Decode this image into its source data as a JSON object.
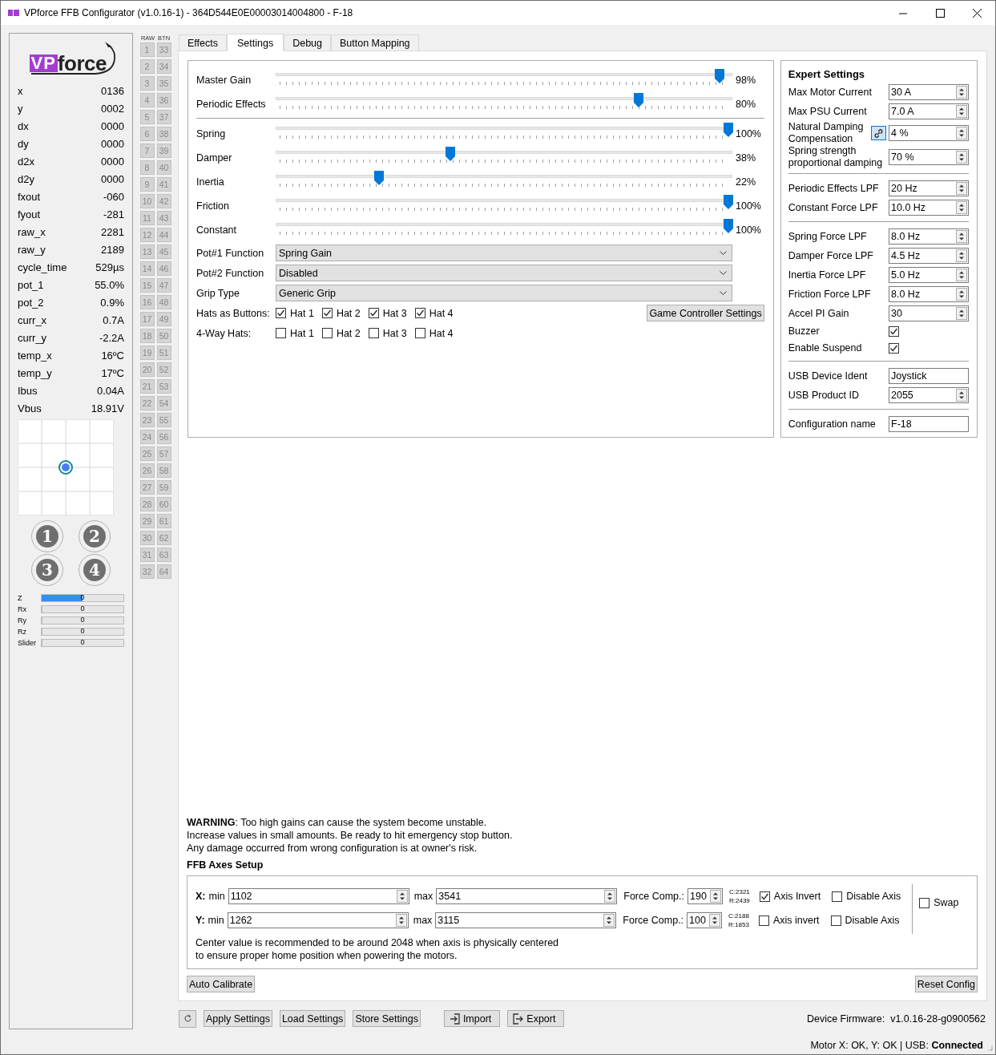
{
  "window": {
    "title": "VPforce FFB Configurator (v1.0.16-1) - 364D544E0E00003014004800 - F-18"
  },
  "sidebar": {
    "logo": {
      "accent": "VP",
      "text": "force"
    },
    "readouts": [
      {
        "label": "x",
        "value": "0136"
      },
      {
        "label": "y",
        "value": "0002"
      },
      {
        "label": "dx",
        "value": "0000"
      },
      {
        "label": "dy",
        "value": "0000"
      },
      {
        "label": "d2x",
        "value": "0000"
      },
      {
        "label": "d2y",
        "value": "0000"
      },
      {
        "label": "fxout",
        "value": "-060"
      },
      {
        "label": "fyout",
        "value": "-281"
      },
      {
        "label": "raw_x",
        "value": "2281"
      },
      {
        "label": "raw_y",
        "value": "2189"
      },
      {
        "label": "cycle_time",
        "value": "529µs"
      },
      {
        "label": "pot_1",
        "value": "55.0%"
      },
      {
        "label": "pot_2",
        "value": "0.9%"
      },
      {
        "label": "curr_x",
        "value": "0.7A"
      },
      {
        "label": "curr_y",
        "value": "-2.2A"
      },
      {
        "label": "temp_x",
        "value": "16ºC"
      },
      {
        "label": "temp_y",
        "value": "17ºC"
      },
      {
        "label": "Ibus",
        "value": "0.04A"
      },
      {
        "label": "Vbus",
        "value": "18.91V"
      }
    ],
    "hat_buttons": [
      "1",
      "2",
      "3",
      "4"
    ],
    "axes": [
      {
        "label": "Z",
        "level": 0.5,
        "reading": "0"
      },
      {
        "label": "Rx",
        "level": 0,
        "reading": "0"
      },
      {
        "label": "Ry",
        "level": 0,
        "reading": "0"
      },
      {
        "label": "Rz",
        "level": 0,
        "reading": "0"
      },
      {
        "label": "Slider",
        "level": 0,
        "reading": "0"
      }
    ]
  },
  "raw_buttons": {
    "headers": [
      "RAW",
      "BTN"
    ],
    "columns": [
      [
        "1",
        "2",
        "3",
        "4",
        "5",
        "6",
        "7",
        "8",
        "9",
        "10",
        "11",
        "12",
        "13",
        "14",
        "15",
        "16",
        "17",
        "18",
        "19",
        "20",
        "21",
        "22",
        "23",
        "24",
        "25",
        "26",
        "27",
        "28",
        "29",
        "30",
        "31",
        "32"
      ],
      [
        "33",
        "34",
        "35",
        "36",
        "37",
        "38",
        "39",
        "40",
        "41",
        "42",
        "43",
        "44",
        "45",
        "46",
        "47",
        "48",
        "49",
        "50",
        "51",
        "52",
        "53",
        "54",
        "55",
        "56",
        "57",
        "58",
        "59",
        "60",
        "61",
        "62",
        "63",
        "64"
      ]
    ]
  },
  "tabs": [
    {
      "label": "Effects",
      "selected": false
    },
    {
      "label": "Settings",
      "selected": true
    },
    {
      "label": "Debug",
      "selected": false
    },
    {
      "label": "Button Mapping",
      "selected": false
    }
  ],
  "sliders": [
    [
      {
        "label": "Master Gain",
        "level": 0.98,
        "reading": "98%"
      },
      {
        "label": "Periodic Effects",
        "level": 0.8,
        "reading": "80%"
      }
    ],
    [
      {
        "label": "Spring",
        "level": 1,
        "reading": "100%"
      },
      {
        "label": "Damper",
        "level": 0.38,
        "reading": "38%"
      },
      {
        "label": "Inertia",
        "level": 0.22,
        "reading": "22%"
      },
      {
        "label": "Friction",
        "level": 1,
        "reading": "100%"
      },
      {
        "label": "Constant",
        "level": 1,
        "reading": "100%"
      }
    ]
  ],
  "dropdowns": [
    {
      "label": "Pot#1 Function",
      "value": "Spring Gain"
    },
    {
      "label": "Pot#2 Function",
      "value": "Disabled"
    },
    {
      "label": "Grip Type",
      "value": "Generic Grip"
    }
  ],
  "hat_options": [
    {
      "label": "Hats as Buttons:",
      "items": [
        {
          "label": "Hat 1",
          "checked": true
        },
        {
          "label": "Hat 2",
          "checked": true
        },
        {
          "label": "Hat 3",
          "checked": true
        },
        {
          "label": "Hat 4",
          "checked": true
        }
      ]
    },
    {
      "label": "4-Way Hats:",
      "items": [
        {
          "label": "Hat 1",
          "checked": false
        },
        {
          "label": "Hat 2",
          "checked": false
        },
        {
          "label": "Hat 3",
          "checked": false
        },
        {
          "label": "Hat 4",
          "checked": false
        }
      ]
    }
  ],
  "controller_button": "Game Controller Settings",
  "expert": {
    "title": "Expert Settings",
    "groups": [
      [
        {
          "kind": "spin",
          "label": "Max Motor Current",
          "value": "30 A"
        },
        {
          "kind": "spin",
          "label": "Max PSU Current",
          "value": "7.0 A"
        },
        {
          "kind": "spin",
          "label": "Natural Damping Compensation",
          "value": "4 %",
          "link": true
        },
        {
          "kind": "spin",
          "label": "Spring strength proportional damping",
          "value": "70 %"
        }
      ],
      [
        {
          "kind": "spin",
          "label": "Periodic Effects LPF",
          "value": "20 Hz"
        },
        {
          "kind": "spin",
          "label": "Constant Force LPF",
          "value": "10.0 Hz"
        }
      ],
      [
        {
          "kind": "spin",
          "label": "Spring Force LPF",
          "value": "8.0 Hz"
        },
        {
          "kind": "spin",
          "label": "Damper Force LPF",
          "value": "4.5 Hz"
        },
        {
          "kind": "spin",
          "label": "Inertia Force LPF",
          "value": "5.0 Hz"
        },
        {
          "kind": "spin",
          "label": "Friction Force LPF",
          "value": "8.0 Hz"
        },
        {
          "kind": "spin",
          "label": "Accel PI Gain",
          "value": "30"
        },
        {
          "kind": "check",
          "label": "Buzzer",
          "checked": true
        },
        {
          "kind": "check",
          "label": "Enable Suspend",
          "checked": true
        }
      ],
      [
        {
          "kind": "text",
          "label": "USB Device Ident",
          "value": "Joystick"
        },
        {
          "kind": "spin",
          "label": "USB Product ID",
          "value": "2055"
        }
      ],
      [
        {
          "kind": "text",
          "label": "Configuration name",
          "value": "F-18"
        }
      ]
    ]
  },
  "warning": [
    "**WARNING**: Too high gains can cause the system become unstable.",
    "Increase values in small amounts. Be ready to hit emergency stop button.",
    "Any damage occurred from wrong configuration is at owner's risk."
  ],
  "axes_setup": {
    "title": "FFB Axes Setup",
    "rows": [
      {
        "axis": "X:",
        "min_label": "min",
        "min": "1102",
        "max_label": "max",
        "max": "3541",
        "force_label": "Force Comp.:",
        "force": "190",
        "c": "C:2321",
        "r": "R:2439",
        "invert": {
          "label": "Axis Invert",
          "checked": true
        },
        "disable": {
          "label": "Disable Axis",
          "checked": false
        }
      },
      {
        "axis": "Y:",
        "min_label": "min",
        "min": "1262",
        "max_label": "max",
        "max": "3115",
        "force_label": "Force Comp.:",
        "force": "100",
        "c": "C:2188",
        "r": "R:1853",
        "invert": {
          "label": "Axis invert",
          "checked": false
        },
        "disable": {
          "label": "Disable Axis",
          "checked": false
        }
      }
    ],
    "swap": {
      "label": "Swap",
      "checked": false
    },
    "note": [
      "Center value is recommended to be around 2048 when axis is physically centered",
      "to ensure proper home position when powering the motors."
    ],
    "calibrate_button": "Auto Calibrate",
    "reset_button": "Reset Config"
  },
  "footer": {
    "buttons": [
      {
        "kind": "refresh"
      },
      {
        "kind": "text",
        "label": "Apply Settings"
      },
      {
        "kind": "text",
        "label": "Load Settings"
      },
      {
        "kind": "text",
        "label": "Store Settings"
      },
      {
        "kind": "import",
        "label": "Import"
      },
      {
        "kind": "export",
        "label": "Export"
      }
    ],
    "firmware_label": "Device Firmware:",
    "firmware": "v1.0.16-28-g0900562"
  },
  "status": "Motor X: OK, Y: OK | USB: **Connected**"
}
